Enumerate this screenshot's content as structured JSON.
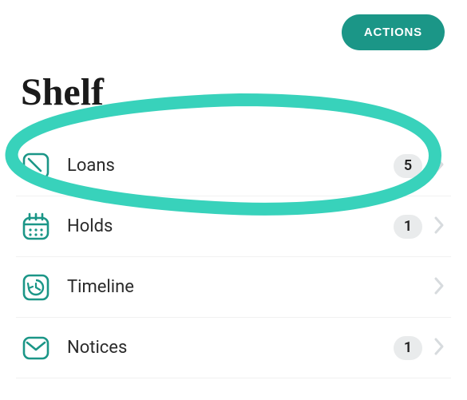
{
  "header": {
    "actions_label": "ACTIONS"
  },
  "page": {
    "title": "Shelf"
  },
  "rows": [
    {
      "label": "Loans",
      "count": "5",
      "icon": "loans-icon",
      "highlighted": true
    },
    {
      "label": "Holds",
      "count": "1",
      "icon": "holds-icon",
      "highlighted": false
    },
    {
      "label": "Timeline",
      "count": null,
      "icon": "timeline-icon",
      "highlighted": false
    },
    {
      "label": "Notices",
      "count": "1",
      "icon": "notices-icon",
      "highlighted": false
    }
  ],
  "colors": {
    "accent": "#1b9687",
    "highlight_stroke": "#38d2bb"
  }
}
